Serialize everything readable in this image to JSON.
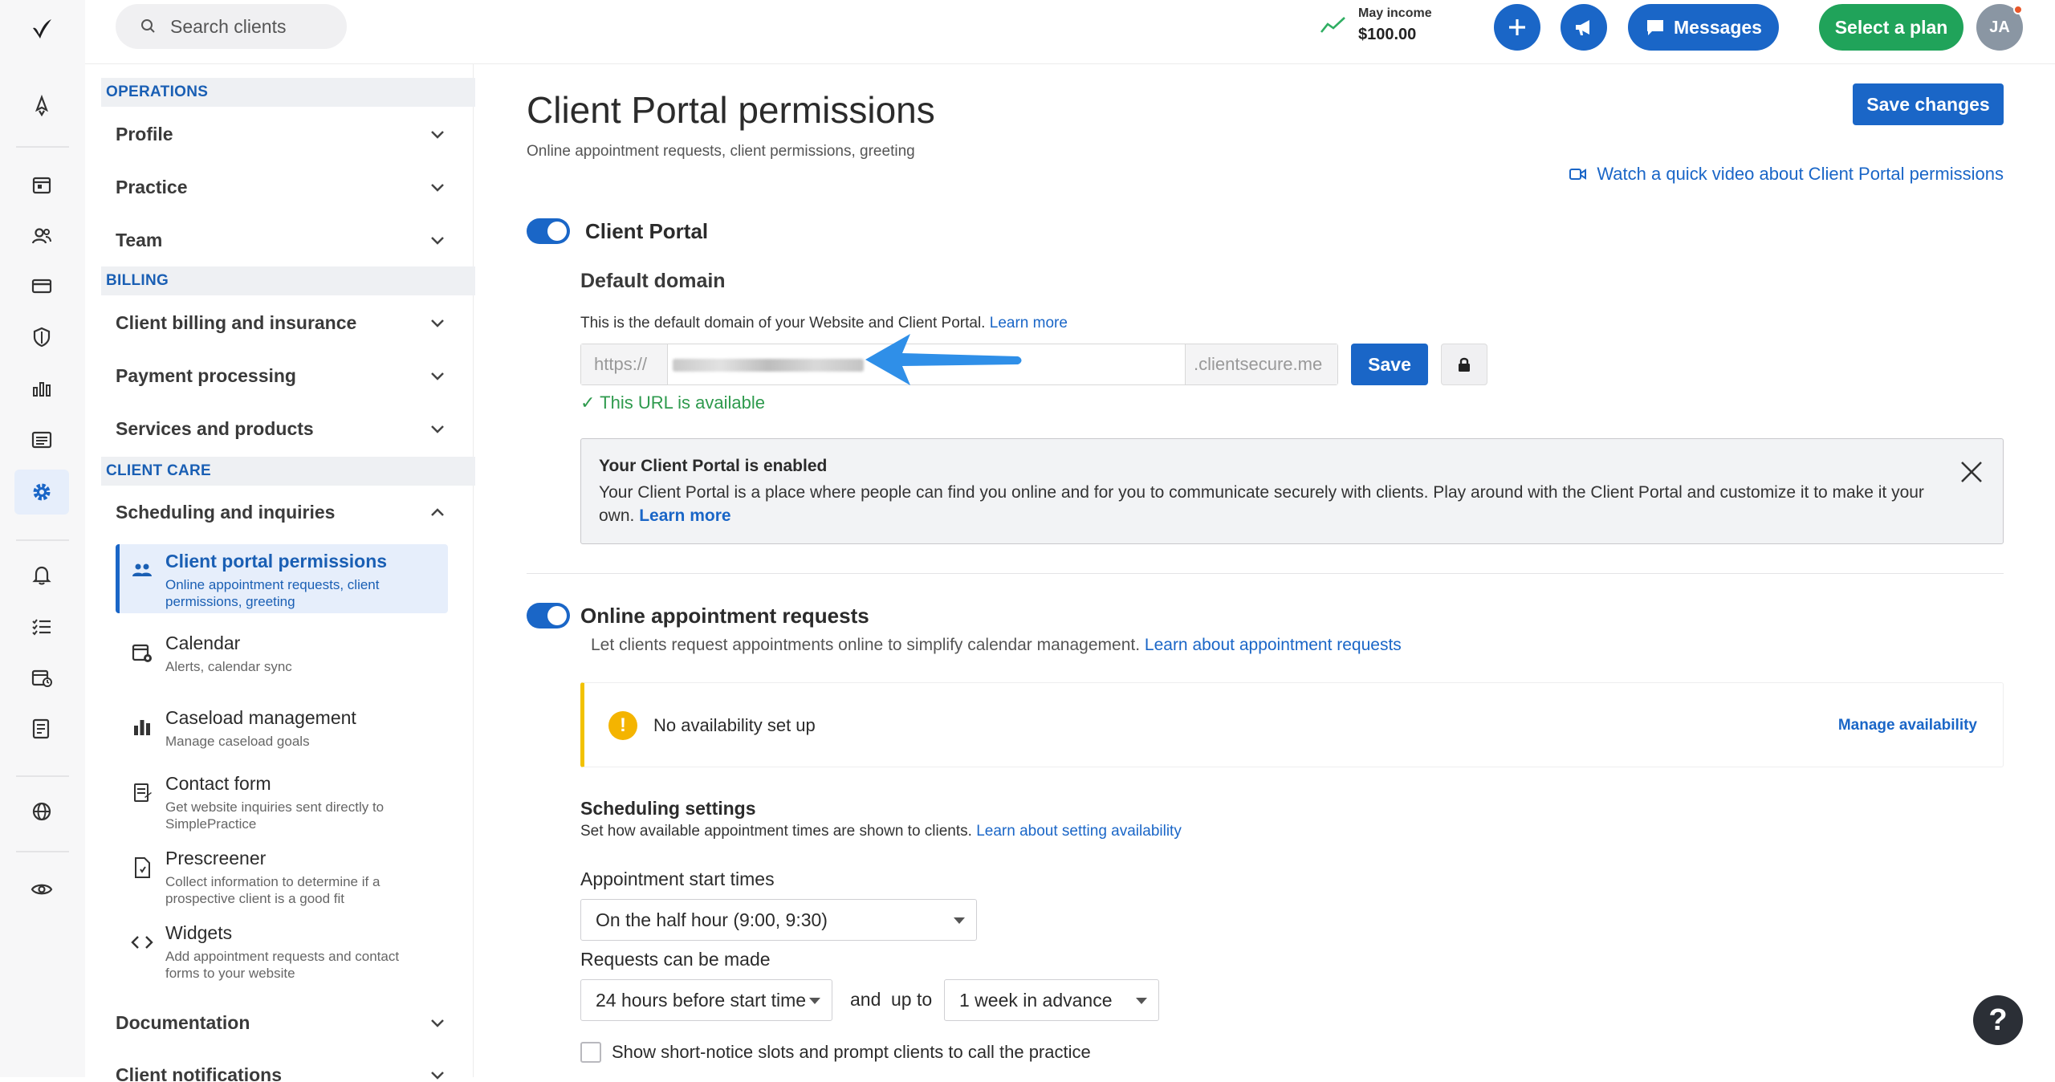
{
  "topbar": {
    "search_placeholder": "Search clients",
    "income_label": "May income",
    "income_value": "$100.00",
    "messages_label": "Messages",
    "plan_label": "Select a plan",
    "avatar_initials": "JA"
  },
  "rail": {
    "icons": [
      "logo-icon",
      "rocket-icon",
      "calendar-icon",
      "clients-icon",
      "billing-icon",
      "insurance-icon",
      "analytics-icon",
      "documents-icon",
      "settings-icon",
      "bell-icon",
      "tasks-icon",
      "schedule-icon",
      "notes-icon",
      "globe-icon",
      "eye-icon"
    ],
    "active": "settings-icon"
  },
  "sidenav": {
    "operations_header": "OPERATIONS",
    "profile": "Profile",
    "practice": "Practice",
    "team": "Team",
    "billing_header": "BILLING",
    "client_billing": "Client billing and insurance",
    "payment_processing": "Payment processing",
    "services_products": "Services and products",
    "client_care_header": "CLIENT CARE",
    "scheduling": "Scheduling and inquiries",
    "sub_items": [
      {
        "title": "Client portal permissions",
        "desc": "Online appointment requests, client permissions, greeting"
      },
      {
        "title": "Calendar",
        "desc": "Alerts, calendar sync"
      },
      {
        "title": "Caseload management",
        "desc": "Manage caseload goals"
      },
      {
        "title": "Contact form",
        "desc": "Get website inquiries sent directly to SimplePractice"
      },
      {
        "title": "Prescreener",
        "desc": "Collect information to determine if a prospective client is a good fit"
      },
      {
        "title": "Widgets",
        "desc": "Add appointment requests and contact forms to your website"
      }
    ],
    "documentation": "Documentation",
    "client_notifications": "Client notifications"
  },
  "main": {
    "title": "Client Portal permissions",
    "subtitle": "Online appointment requests, client permissions, greeting",
    "save_changes": "Save changes",
    "video_link": "Watch a quick video about Client Portal permissions",
    "client_portal_label": "Client Portal",
    "client_portal_enabled": true,
    "default_domain_title": "Default domain",
    "domain_desc": "This is the default domain of your Website and Client Portal.",
    "domain_learn_more": "Learn more",
    "domain_prefix": "https://",
    "domain_suffix": ".clientsecure.me",
    "domain_save": "Save",
    "url_available": "This URL is available",
    "enabled_title": "Your Client Portal is enabled",
    "enabled_body": "Your Client Portal is a place where people can find you online and for you to communicate securely with clients. Play around with the Client Portal and customize it to make it your own.",
    "enabled_learn_more": "Learn more",
    "oar_label": "Online appointment requests",
    "oar_enabled": true,
    "oar_desc": "Let clients request appointments online to simplify calendar management.",
    "oar_link": "Learn about appointment requests",
    "no_availability": "No availability set up",
    "manage_availability": "Manage availability",
    "sched_title": "Scheduling settings",
    "sched_desc": "Set how available appointment times are shown to clients.",
    "sched_link": "Learn about setting availability",
    "start_times_label": "Appointment start times",
    "start_times_value": "On the half hour (9:00, 9:30)",
    "requests_label": "Requests can be made",
    "requests_before_value": "24 hours before start time",
    "and_text": "and",
    "up_to_text": "up to",
    "requests_advance_value": "1 week in advance",
    "short_notice_label": "Show short-notice slots and prompt clients to call the practice",
    "short_notice_checked": false
  },
  "help_label": "?",
  "colors": {
    "primary": "#1a66c7",
    "success": "#20a35a",
    "warning": "#f4b400",
    "arrow": "#2f8fe8"
  }
}
